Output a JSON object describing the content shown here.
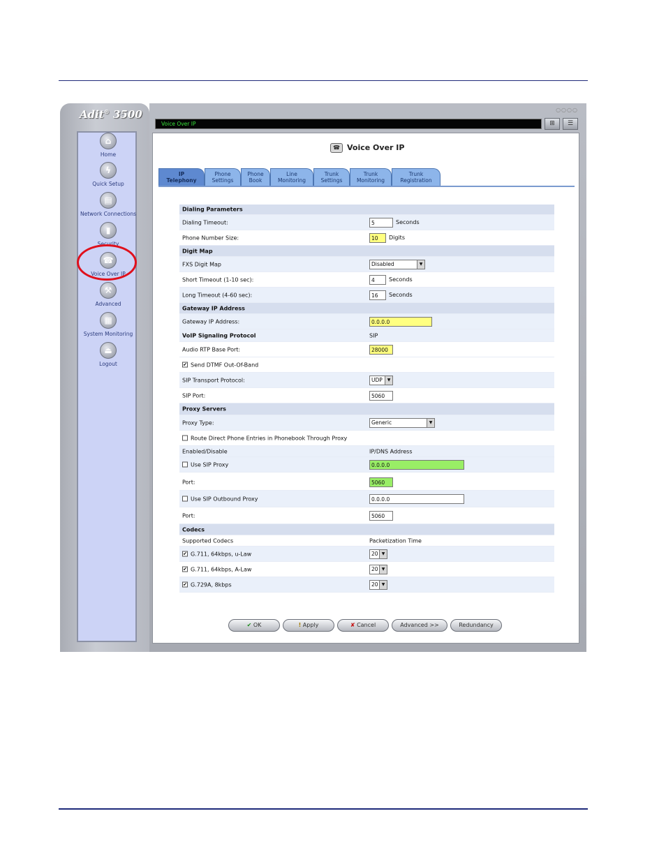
{
  "brand": {
    "name": "Adit",
    "sup": "®",
    "model": "3500"
  },
  "window": {
    "title": "Voice Over IP",
    "dots": "○○○○"
  },
  "nav": [
    {
      "label": "Home",
      "icon": "⌂"
    },
    {
      "label": "Quick Setup",
      "icon": "ϟ"
    },
    {
      "label": "Network Connections",
      "icon": "▤"
    },
    {
      "label": "Security",
      "icon": "▮"
    },
    {
      "label": "Voice Over IP",
      "icon": "☎"
    },
    {
      "label": "Advanced",
      "icon": "⚒"
    },
    {
      "label": "System Monitoring",
      "icon": "▦"
    },
    {
      "label": "Logout",
      "icon": "⏏"
    }
  ],
  "page": {
    "title": "Voice Over IP"
  },
  "tabs": [
    {
      "l1": "IP",
      "l2": "Telephony"
    },
    {
      "l1": "Phone",
      "l2": "Settings"
    },
    {
      "l1": "Phone",
      "l2": "Book"
    },
    {
      "l1": "Line",
      "l2": "Monitoring"
    },
    {
      "l1": "Trunk",
      "l2": "Settings"
    },
    {
      "l1": "Trunk",
      "l2": "Monitoring"
    },
    {
      "l1": "Trunk",
      "l2": "Registration"
    }
  ],
  "form": {
    "dialing_parameters": "Dialing Parameters",
    "dialing_timeout": {
      "label": "Dialing Timeout:",
      "value": "5",
      "unit": "Seconds"
    },
    "phone_number_size": {
      "label": "Phone Number Size:",
      "value": "10",
      "unit": "Digits"
    },
    "digit_map": "Digit Map",
    "fxs_digit_map": {
      "label": "FXS Digit Map",
      "value": "Disabled"
    },
    "short_timeout": {
      "label": "Short Timeout (1-10 sec):",
      "value": "4",
      "unit": "Seconds"
    },
    "long_timeout": {
      "label": "Long Timeout (4-60 sec):",
      "value": "16",
      "unit": "Seconds"
    },
    "gateway_ip_address_section": "Gateway IP Address",
    "gateway_ip_address": {
      "label": "Gateway IP Address:",
      "value": "0.0.0.0"
    },
    "voip_signaling": {
      "label": "VoIP Signaling Protocol",
      "value": "SIP"
    },
    "audio_rtp": {
      "label": "Audio RTP Base Port:",
      "value": "28000"
    },
    "send_dtmf": {
      "label": "Send DTMF Out-Of-Band",
      "checked": "✔"
    },
    "sip_transport": {
      "label": "SIP Transport Protocol:",
      "value": "UDP"
    },
    "sip_port": {
      "label": "SIP Port:",
      "value": "5060"
    },
    "proxy_servers": "Proxy Servers",
    "proxy_type": {
      "label": "Proxy Type:",
      "value": "Generic"
    },
    "route_direct": {
      "label": "Route Direct Phone Entries in Phonebook Through Proxy",
      "checked": ""
    },
    "enabled_disable": {
      "label": "Enabled/Disable",
      "value": "IP/DNS Address"
    },
    "use_sip_proxy": {
      "label": "Use SIP Proxy",
      "value": "0.0.0.0",
      "checked": ""
    },
    "proxy_port": {
      "label": "Port:",
      "value": "5060"
    },
    "use_outbound_proxy": {
      "label": "Use SIP Outbound Proxy",
      "value": "0.0.0.0",
      "checked": ""
    },
    "outbound_port": {
      "label": "Port:",
      "value": "5060"
    },
    "codecs": "Codecs",
    "supported_codecs": {
      "label": "Supported Codecs",
      "value": "Packetization Time"
    },
    "codec1": {
      "label": "G.711, 64kbps, u-Law",
      "value": "20",
      "checked": "✔"
    },
    "codec2": {
      "label": "G.711, 64kbps, A-Law",
      "value": "20",
      "checked": "✔"
    },
    "codec3": {
      "label": "G.729A, 8kbps",
      "value": "20",
      "checked": "✔"
    }
  },
  "buttons": {
    "ok": {
      "icon": "✔",
      "label": "OK"
    },
    "apply": {
      "icon": "!",
      "label": "Apply"
    },
    "cancel": {
      "icon": "✘",
      "label": "Cancel"
    },
    "advanced": "Advanced >>",
    "redundancy": "Redundancy"
  }
}
